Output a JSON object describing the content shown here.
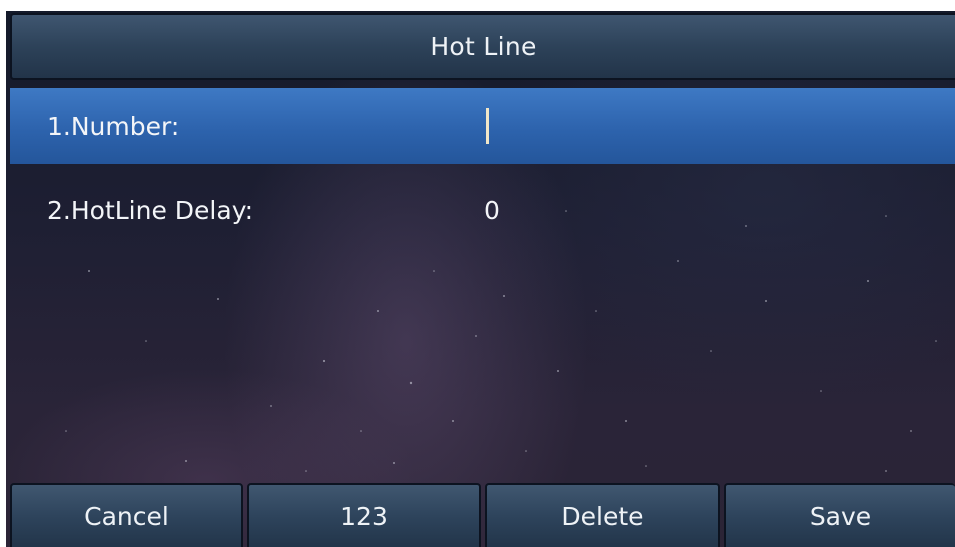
{
  "header": {
    "title": "Hot Line"
  },
  "fields": [
    {
      "label": "1.Number:",
      "value": "",
      "selected": true
    },
    {
      "label": "2.HotLine Delay:",
      "value": "0",
      "selected": false
    }
  ],
  "softkeys": [
    {
      "label": "Cancel"
    },
    {
      "label": "123"
    },
    {
      "label": "Delete"
    },
    {
      "label": "Save"
    }
  ],
  "colors": {
    "selected_row": "#2d63ad",
    "title_bar": "#2d4259",
    "text": "#f3f5f8",
    "cursor": "#f1e7c9"
  }
}
